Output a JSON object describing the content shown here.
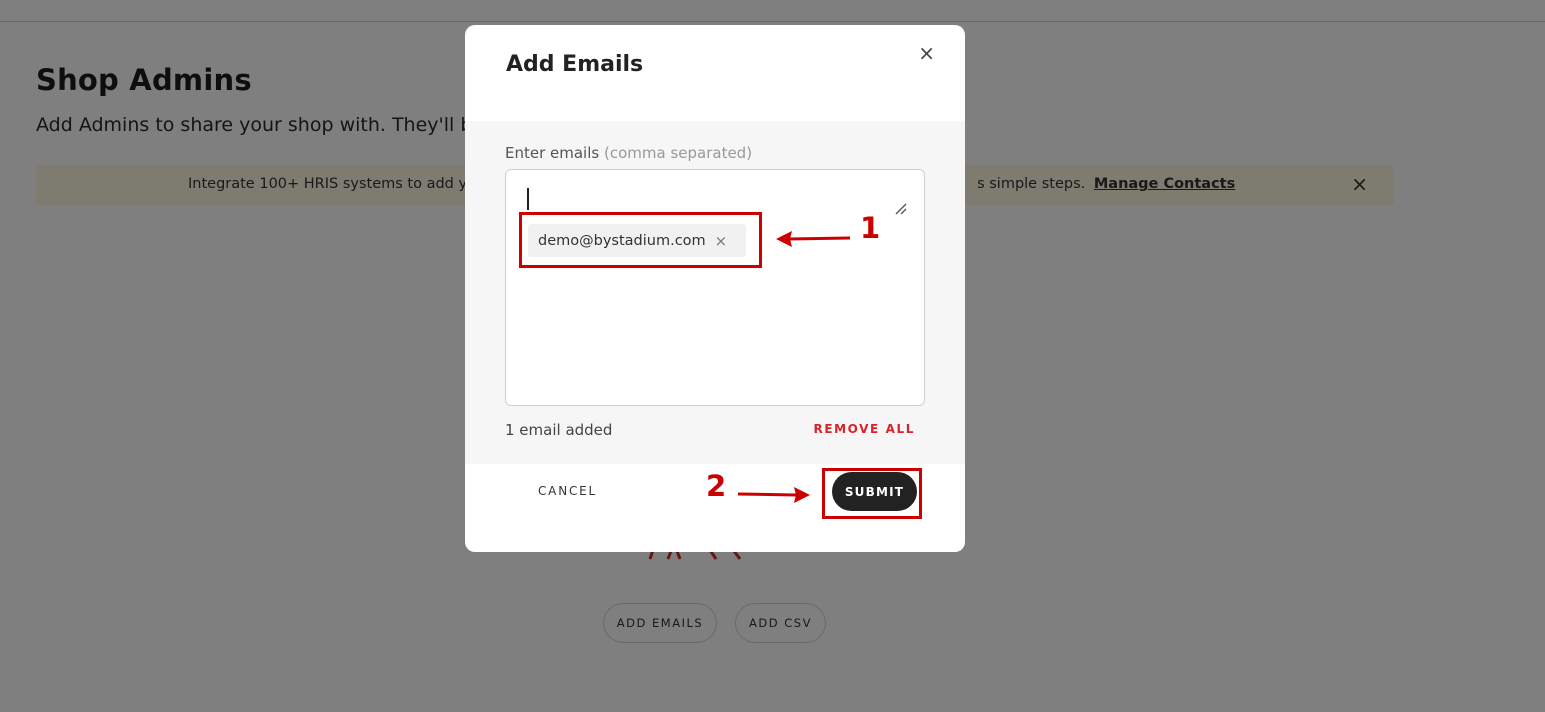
{
  "page": {
    "title": "Shop Admins",
    "subtitle": "Add Admins to share your shop with. They'll be"
  },
  "banner": {
    "text": "Integrate 100+ HRIS systems to add y",
    "text_end": "s simple steps.",
    "link": "Manage Contacts",
    "close": "×"
  },
  "empty_state": {
    "add_emails": "ADD EMAILS",
    "add_csv": "ADD CSV"
  },
  "modal": {
    "title": "Add Emails",
    "close": "×",
    "field_label": "Enter emails",
    "field_hint": "(comma separated)",
    "chip_email": "demo@bystadium.com",
    "chip_remove": "×",
    "count": "1 email added",
    "remove_all": "REMOVE ALL",
    "cancel": "CANCEL",
    "submit": "SUBMIT"
  },
  "annotations": {
    "step1": "1",
    "step2": "2"
  },
  "colors": {
    "accent_red": "#cc0000",
    "remove_all_red": "#d8232a",
    "submit_bg": "#222222",
    "banner_bg": "#fdf9e3"
  }
}
